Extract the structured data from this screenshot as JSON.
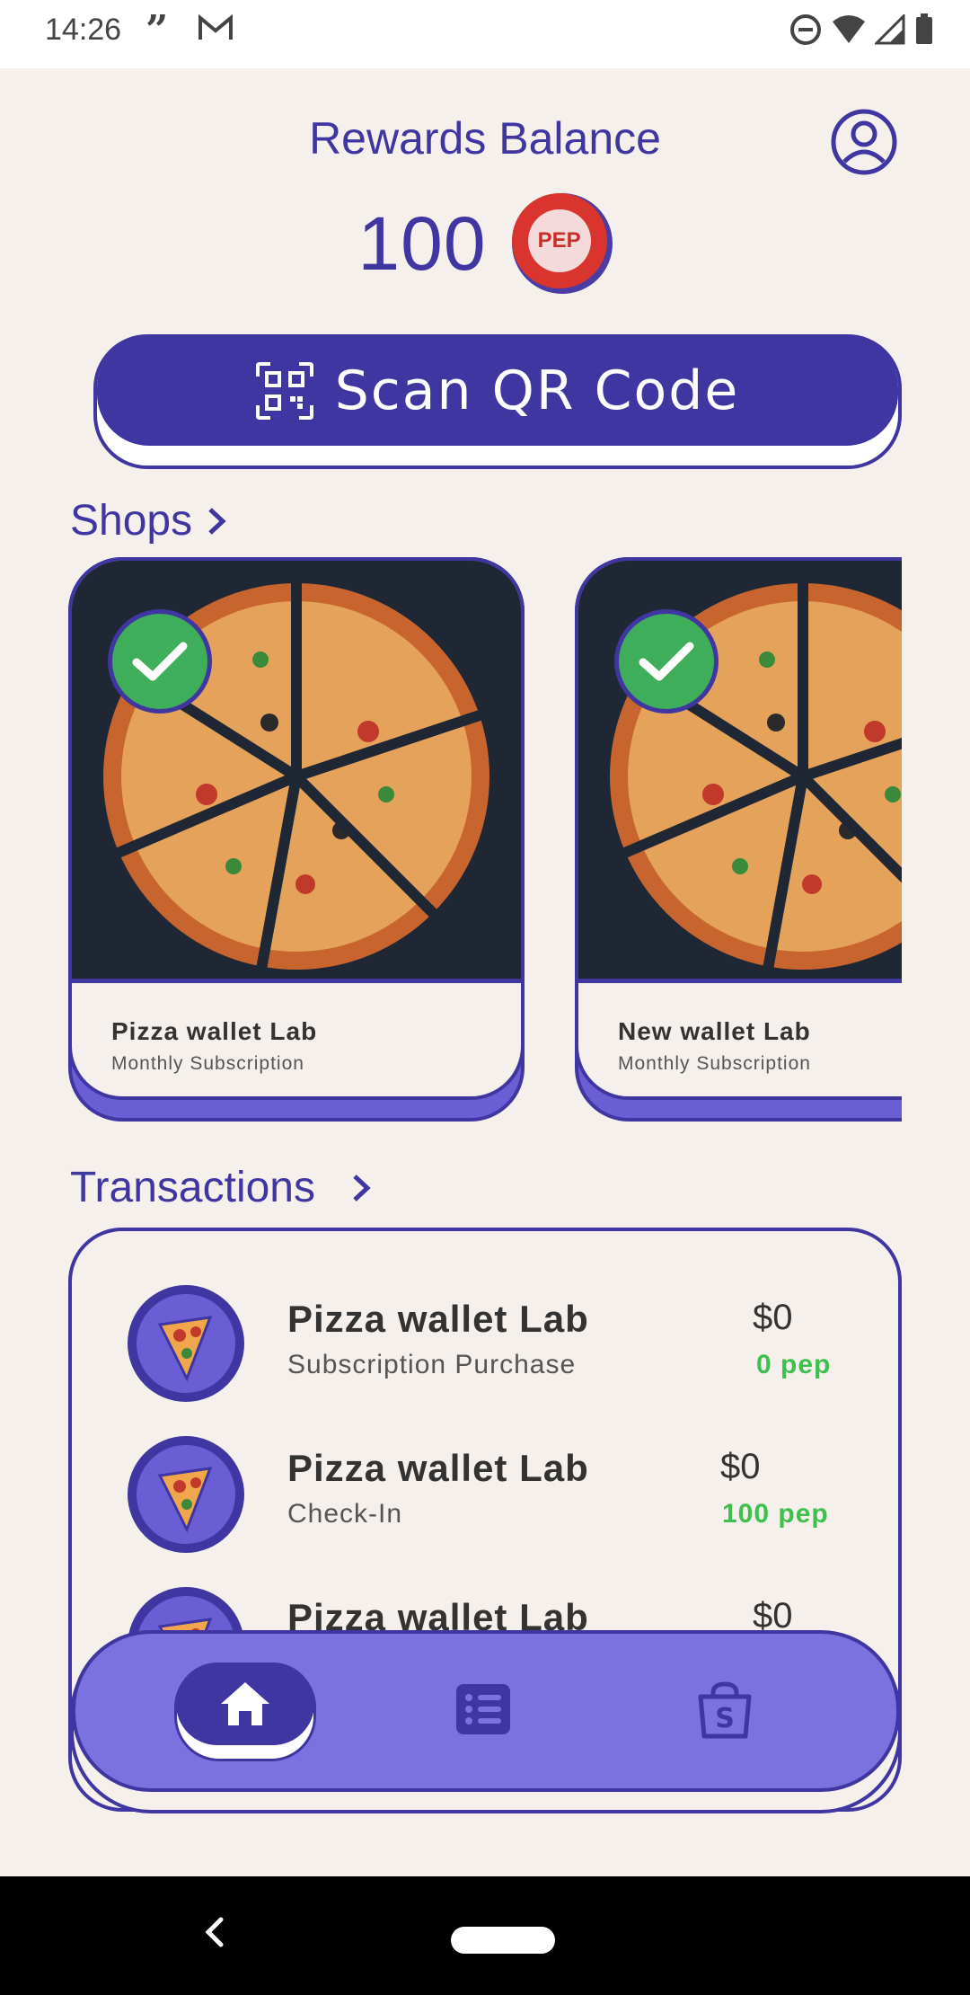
{
  "status_bar": {
    "time": "14:26",
    "quote_glyph": "”",
    "icons": [
      "gmail-icon",
      "dnd-icon",
      "wifi-icon",
      "signal-icon",
      "battery-icon"
    ]
  },
  "header": {
    "title": "Rewards Balance",
    "balance": "100",
    "coin_label": "PEP",
    "profile_icon": "account-circle-icon"
  },
  "scan_button": {
    "label": "Scan QR Code",
    "icon": "qr-code-icon"
  },
  "shops": {
    "heading": "Shops",
    "cards": [
      {
        "name": "Pizza wallet Lab",
        "subtitle": "Monthly Subscription",
        "selected": true
      },
      {
        "name": "New wallet Lab",
        "subtitle": "Monthly Subscription",
        "selected": true
      }
    ]
  },
  "transactions": {
    "heading": "Transactions",
    "rows": [
      {
        "name": "Pizza wallet Lab",
        "type": "Subscription Purchase",
        "amount": "$0",
        "pep": "0 pep"
      },
      {
        "name": "Pizza wallet Lab",
        "type": "Check-In",
        "amount": "$0",
        "pep": "100 pep"
      },
      {
        "name": "Pizza wallet Lab",
        "type": "",
        "amount": "$0",
        "pep": ""
      }
    ]
  },
  "bottom_nav": {
    "items": [
      {
        "icon": "home-icon",
        "active": true
      },
      {
        "icon": "list-icon",
        "active": false
      },
      {
        "icon": "shop-bag-icon",
        "active": false
      }
    ]
  },
  "colors": {
    "primary": "#3f36a1",
    "nav": "#7b72df",
    "background": "#f5f0eb",
    "success": "#3fbf4e",
    "coin": "#d9352e"
  }
}
